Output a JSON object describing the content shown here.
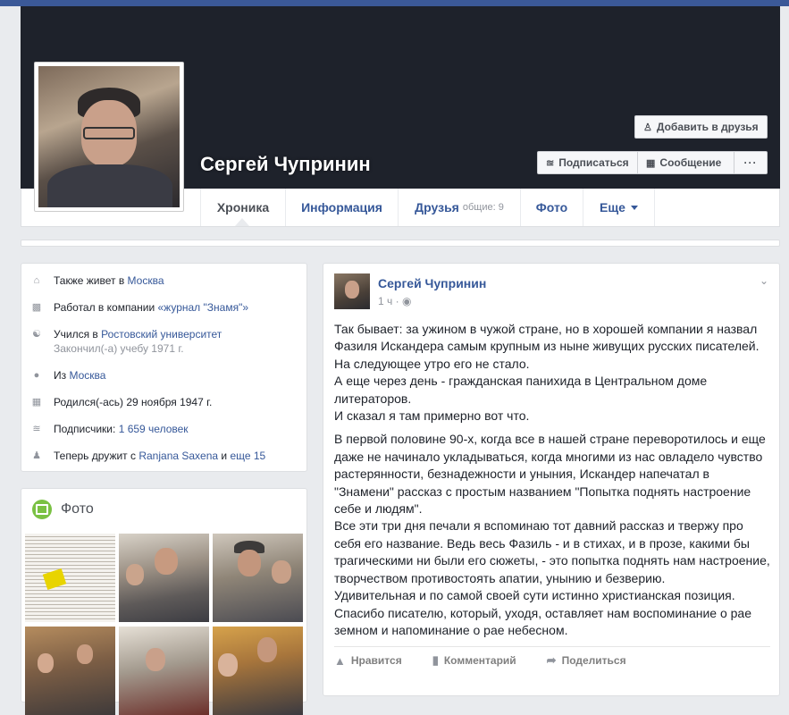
{
  "profile": {
    "name": "Сергей Чупринин",
    "add_friend": "Добавить в друзья",
    "subscribe": "Подписаться",
    "message": "Сообщение",
    "more": "···"
  },
  "tabs": {
    "timeline": "Хроника",
    "info": "Информация",
    "friends": "Друзья",
    "friends_common": "общие: 9",
    "photos": "Фото",
    "more": "Еще"
  },
  "about": {
    "lives_prefix": "Также живет в ",
    "lives_city": "Москва",
    "work_prefix": "Работал в компании ",
    "work_company": "«журнал \"Знамя\"»",
    "study_prefix": "Учился в ",
    "study_school": "Ростовский университет",
    "study_finished": "Закончил(-а) учебу 1971 г.",
    "from_prefix": "Из ",
    "from_city": "Москва",
    "born": "Родился(-ась) 29 ноября 1947 г.",
    "followers_prefix": "Подписчики: ",
    "followers_count": "1 659 человек",
    "friends_prefix": "Теперь дружит с ",
    "friends_name": "Ranjana Saxena",
    "friends_and": " и ",
    "friends_more": "еще 15"
  },
  "photos": {
    "title": "Фото",
    "thumbs": [
      "newspaper-clipping",
      "men-at-table",
      "men-in-caps",
      "group-standing",
      "audience",
      "woman-and-man"
    ]
  },
  "post": {
    "author": "Сергей Чупринин",
    "time": "1 ч · ",
    "paragraph1": "Так бывает: за ужином в чужой стране, но в хорошей компании я назвал Фазиля Искандера самым крупным из ныне живущих русских писателей.\nНа следующее утро его не стало.\nА еще через день - гражданская панихида в Центральном доме литераторов.\nИ сказал я там примерно вот что.",
    "paragraph2": "В первой половине 90-х, когда все в нашей стране переворотилось и еще даже не начинало укладываться, когда многими из нас овладело чувство растерянности, безнадежности и уныния, Искандер напечатал в \"Знамени\" рассказ с простым названием \"Попытка поднять настроение себе и людям\".\nВсе эти три дня печали я вспоминаю тот давний рассказ и твержу про себя его название. Ведь весь Фазиль - и в стихах, и в прозе, какими бы трагическими ни были его сюжеты, - это попытка поднять нам настроение, творчеством противостоять апатии, унынию и безверию.\nУдивительная и по самой своей сути истинно христианская позиция.\nСпасибо писателю, который, уходя, оставляет нам воспоминание о рае земном и напоминание о рае небесном.",
    "like": "Нравится",
    "comment": "Комментарий",
    "share": "Поделиться"
  }
}
